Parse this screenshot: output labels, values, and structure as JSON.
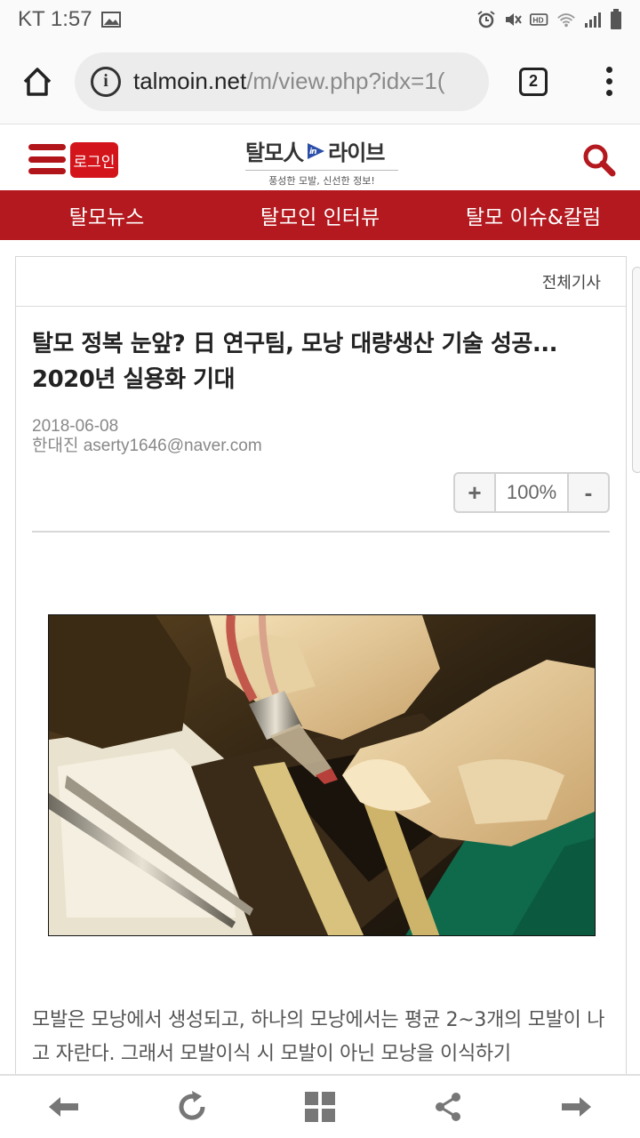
{
  "status_bar": {
    "carrier_time": "KT 1:57",
    "icons": [
      "image-icon",
      "alarm-icon",
      "mute-icon",
      "hd-icon",
      "wifi-icon",
      "signal-icon",
      "battery-icon"
    ]
  },
  "browser": {
    "url_domain": "talmoin.net",
    "url_path": "/m/view.php?idx=1(",
    "tab_count": "2"
  },
  "site": {
    "login_label": "로그인",
    "logo_left": "탈모人",
    "logo_in": "in",
    "logo_right": "라이브",
    "logo_tagline": "풍성한 모발, 신선한 정보!"
  },
  "nav": {
    "items": [
      "탈모뉴스",
      "탈모인 인터뷰",
      "탈모 이슈&칼럼"
    ]
  },
  "card": {
    "all_articles": "전체기사"
  },
  "article": {
    "title": "탈모 정복 눈앞? 日 연구팀, 모낭 대량생산 기술 성공... 2020년 실용화 기대",
    "date": "2018-06-08",
    "author": "한대진 aserty1646@naver.com",
    "zoom_plus": "+",
    "zoom_value": "100%",
    "zoom_minus": "-",
    "body": "모발은 모낭에서 생성되고, 하나의 모낭에서는 평균 2~3개의 모발이 나고 자란다. 그래서 모발이식 시 모발이 아닌 모낭을 이식하기"
  },
  "colors": {
    "brand_red": "#b3191e",
    "login_red": "#d4141b"
  }
}
